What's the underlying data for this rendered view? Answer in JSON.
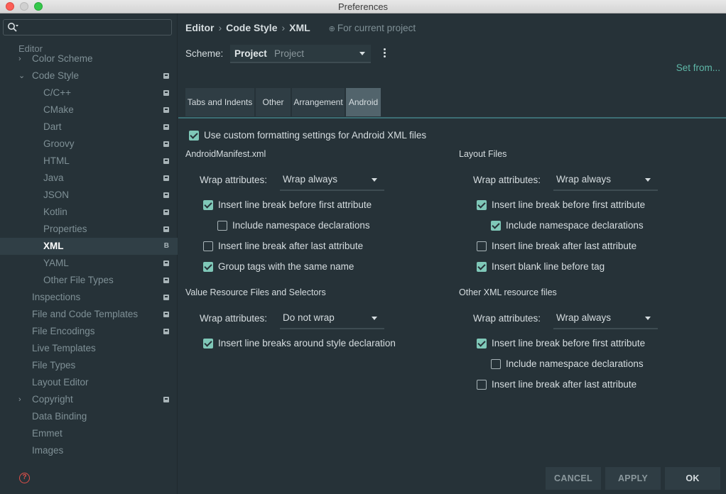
{
  "window": {
    "title": "Preferences"
  },
  "sidebar": {
    "search_placeholder": "",
    "section": "Editor",
    "items": [
      {
        "label": "Color Scheme",
        "indent": 1,
        "arrow": "›",
        "badge": false
      },
      {
        "label": "Code Style",
        "indent": 1,
        "arrow": "⌄",
        "badge": true
      },
      {
        "label": "C/C++",
        "indent": 2,
        "badge": true
      },
      {
        "label": "CMake",
        "indent": 2,
        "badge": true
      },
      {
        "label": "Dart",
        "indent": 2,
        "badge": true
      },
      {
        "label": "Groovy",
        "indent": 2,
        "badge": true
      },
      {
        "label": "HTML",
        "indent": 2,
        "badge": true
      },
      {
        "label": "Java",
        "indent": 2,
        "badge": true
      },
      {
        "label": "JSON",
        "indent": 2,
        "badge": true
      },
      {
        "label": "Kotlin",
        "indent": 2,
        "badge": true
      },
      {
        "label": "Properties",
        "indent": 2,
        "badge": true
      },
      {
        "label": "XML",
        "indent": 2,
        "badge": true,
        "selected": true
      },
      {
        "label": "YAML",
        "indent": 2,
        "badge": true
      },
      {
        "label": "Other File Types",
        "indent": 2,
        "badge": true
      },
      {
        "label": "Inspections",
        "indent": 1,
        "badge": true
      },
      {
        "label": "File and Code Templates",
        "indent": 1,
        "badge": true
      },
      {
        "label": "File Encodings",
        "indent": 1,
        "badge": true
      },
      {
        "label": "Live Templates",
        "indent": 1,
        "badge": false
      },
      {
        "label": "File Types",
        "indent": 1,
        "badge": false
      },
      {
        "label": "Layout Editor",
        "indent": 1,
        "badge": false
      },
      {
        "label": "Copyright",
        "indent": 1,
        "arrow": "›",
        "badge": true
      },
      {
        "label": "Data Binding",
        "indent": 1,
        "badge": false
      },
      {
        "label": "Emmet",
        "indent": 1,
        "badge": false
      },
      {
        "label": "Images",
        "indent": 1,
        "badge": false
      }
    ],
    "selected_badge_letter": "B",
    "help_glyph": "?"
  },
  "breadcrumb": {
    "items": [
      "Editor",
      "Code Style",
      "XML"
    ],
    "separator": "›",
    "project_note": "For current project"
  },
  "scheme": {
    "label": "Scheme:",
    "value_bold": "Project",
    "value_light": "Project",
    "set_from": "Set from..."
  },
  "tabs": [
    "Tabs and Indents",
    "Other",
    "Arrangement",
    "Android"
  ],
  "active_tab": "Android",
  "android": {
    "use_custom": {
      "label": "Use custom formatting settings for Android XML files",
      "checked": true
    },
    "manifest": {
      "title": "AndroidManifest.xml",
      "wrap_label": "Wrap attributes:",
      "wrap_value": "Wrap always",
      "options": [
        {
          "label": "Insert line break before first attribute",
          "checked": true
        },
        {
          "label": "Include namespace declarations",
          "checked": false
        },
        {
          "label": "Insert line break after last attribute",
          "checked": false
        },
        {
          "label": "Group tags with the same name",
          "checked": true
        }
      ]
    },
    "layout": {
      "title": "Layout Files",
      "wrap_label": "Wrap attributes:",
      "wrap_value": "Wrap always",
      "options": [
        {
          "label": "Insert line break before first attribute",
          "checked": true
        },
        {
          "label": "Include namespace declarations",
          "checked": true
        },
        {
          "label": "Insert line break after last attribute",
          "checked": false
        },
        {
          "label": "Insert blank line before tag",
          "checked": true
        }
      ]
    },
    "values": {
      "title": "Value Resource Files and Selectors",
      "wrap_label": "Wrap attributes:",
      "wrap_value": "Do not wrap",
      "options": [
        {
          "label": "Insert line breaks around style declaration",
          "checked": true
        }
      ]
    },
    "other": {
      "title": "Other XML resource files",
      "wrap_label": "Wrap attributes:",
      "wrap_value": "Wrap always",
      "options": [
        {
          "label": "Insert line break before first attribute",
          "checked": true
        },
        {
          "label": "Include namespace declarations",
          "checked": false
        },
        {
          "label": "Insert line break after last attribute",
          "checked": false
        }
      ]
    }
  },
  "buttons": {
    "cancel": "CANCEL",
    "apply": "APPLY",
    "ok": "OK"
  },
  "colors": {
    "background": "#263238",
    "accent": "#7fc8b8",
    "link": "#5fb8a8"
  }
}
